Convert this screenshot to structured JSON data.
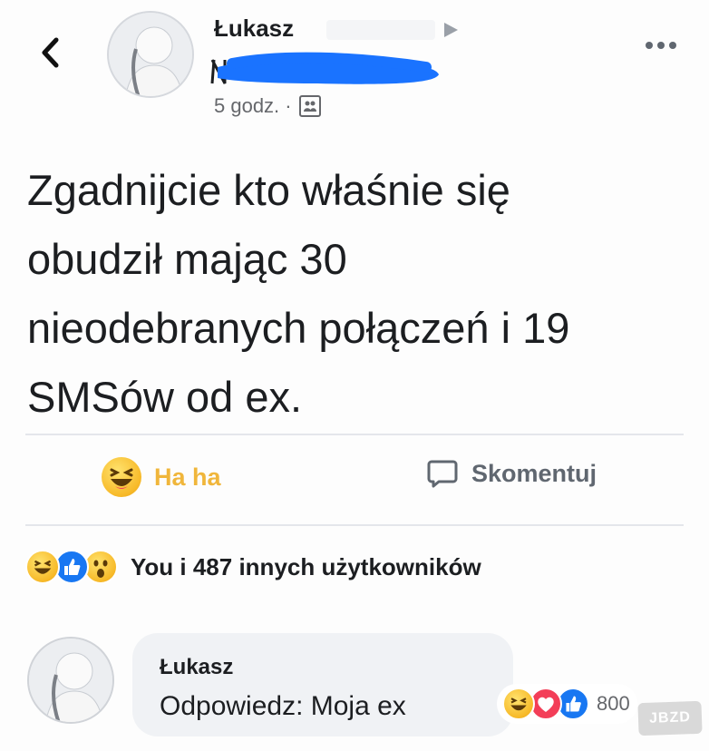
{
  "post": {
    "author_name": "Łukasz",
    "time": "5 godz. ·",
    "text": "Zgadnijcie kto właśnie się\nobudził mając 30\nnieodebranych połączeń i 19\nSMSów od ex."
  },
  "actions": {
    "haha_label": "Ha ha",
    "comment_label": "Skomentuj"
  },
  "reactions": {
    "icons": [
      "haha-icon",
      "like-icon",
      "wow-icon"
    ],
    "summary": "You i 487 innych użytkowników"
  },
  "comment": {
    "author": "Łukasz",
    "text": "Odpowiedz: Moja ex",
    "reaction_icons": [
      "haha-icon",
      "love-icon",
      "like-icon"
    ],
    "reaction_count": "800"
  },
  "watermark": "JBZD",
  "colors": {
    "haha": "#f7b928",
    "like": "#1877f2",
    "love": "#f33e58",
    "redaction": "#1a73ff"
  }
}
